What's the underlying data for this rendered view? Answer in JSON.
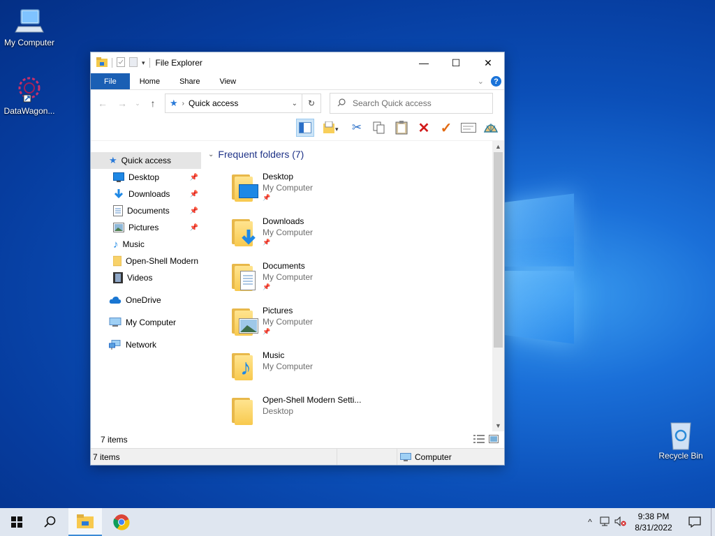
{
  "desktop": {
    "icons": [
      {
        "label": "My Computer"
      },
      {
        "label": "DataWagon..."
      },
      {
        "label": "Recycle Bin"
      }
    ]
  },
  "window": {
    "title": "File Explorer",
    "controls": {
      "minimize": "—",
      "maximize": "☐",
      "close": "✕"
    }
  },
  "ribbon": {
    "tabs": [
      "File",
      "Home",
      "Share",
      "View"
    ]
  },
  "address": {
    "location": "Quick access",
    "search_placeholder": "Search Quick access"
  },
  "nav": {
    "items": [
      {
        "label": "Quick access",
        "pinned": false
      },
      {
        "label": "Desktop",
        "pinned": true
      },
      {
        "label": "Downloads",
        "pinned": true
      },
      {
        "label": "Documents",
        "pinned": true
      },
      {
        "label": "Pictures",
        "pinned": true
      },
      {
        "label": "Music",
        "pinned": false
      },
      {
        "label": "Open-Shell Modern",
        "pinned": false
      },
      {
        "label": "Videos",
        "pinned": false
      },
      {
        "label": "OneDrive",
        "pinned": false
      },
      {
        "label": "My Computer",
        "pinned": false
      },
      {
        "label": "Network",
        "pinned": false
      }
    ]
  },
  "main": {
    "group_title": "Frequent folders (7)",
    "folders": [
      {
        "name": "Desktop",
        "location": "My Computer",
        "pinned": true
      },
      {
        "name": "Downloads",
        "location": "My Computer",
        "pinned": true
      },
      {
        "name": "Documents",
        "location": "My Computer",
        "pinned": true
      },
      {
        "name": "Pictures",
        "location": "My Computer",
        "pinned": true
      },
      {
        "name": "Music",
        "location": "My Computer",
        "pinned": false
      },
      {
        "name": "Open-Shell Modern Setti...",
        "location": "Desktop",
        "pinned": false
      }
    ]
  },
  "info_bar": {
    "item_count": "7 items"
  },
  "statusbar": {
    "left": "7 items",
    "right": "Computer"
  },
  "taskbar": {
    "time": "9:38 PM",
    "date": "8/31/2022"
  },
  "colors": {
    "accent": "#1a5fb4",
    "selection": "#cce4f7",
    "group_header": "#1e3287"
  }
}
